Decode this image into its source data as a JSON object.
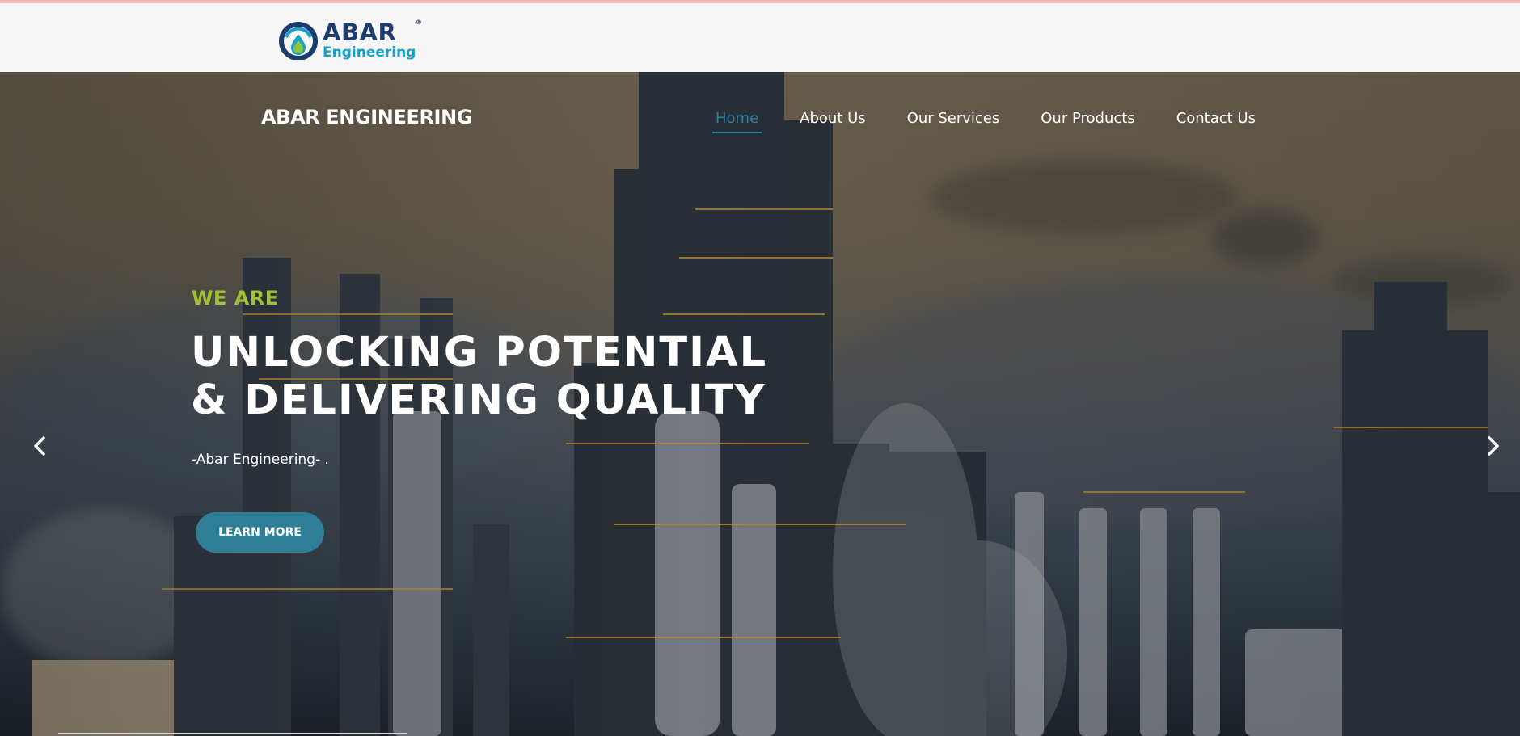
{
  "brand": {
    "logo_word": "ABAR",
    "logo_registered": "®",
    "logo_sub": "Engineering",
    "site_name": "ABAR ENGINEERING"
  },
  "nav": {
    "items": [
      {
        "label": "Home",
        "active": true
      },
      {
        "label": "About Us",
        "active": false
      },
      {
        "label": "Our Services",
        "active": false
      },
      {
        "label": "Our Products",
        "active": false
      },
      {
        "label": "Contact Us",
        "active": false
      }
    ]
  },
  "hero": {
    "tagline": "WE ARE",
    "headline_line1": "UNLOCKING POTENTIAL",
    "headline_line2": "& DELIVERING QUALITY",
    "subtext": "-Abar Engineering- .",
    "cta_label": "LEARN MORE",
    "prev_icon": "chevron-left-icon",
    "next_icon": "chevron-right-icon"
  },
  "colors": {
    "nav_active": "#2f7fa6",
    "tagline": "#a2c13a",
    "cta_bg": "#2f7d96",
    "logo_dark": "#1d3c6e",
    "logo_light": "#1aa1c9",
    "logo_drop": "#8cc63f"
  }
}
